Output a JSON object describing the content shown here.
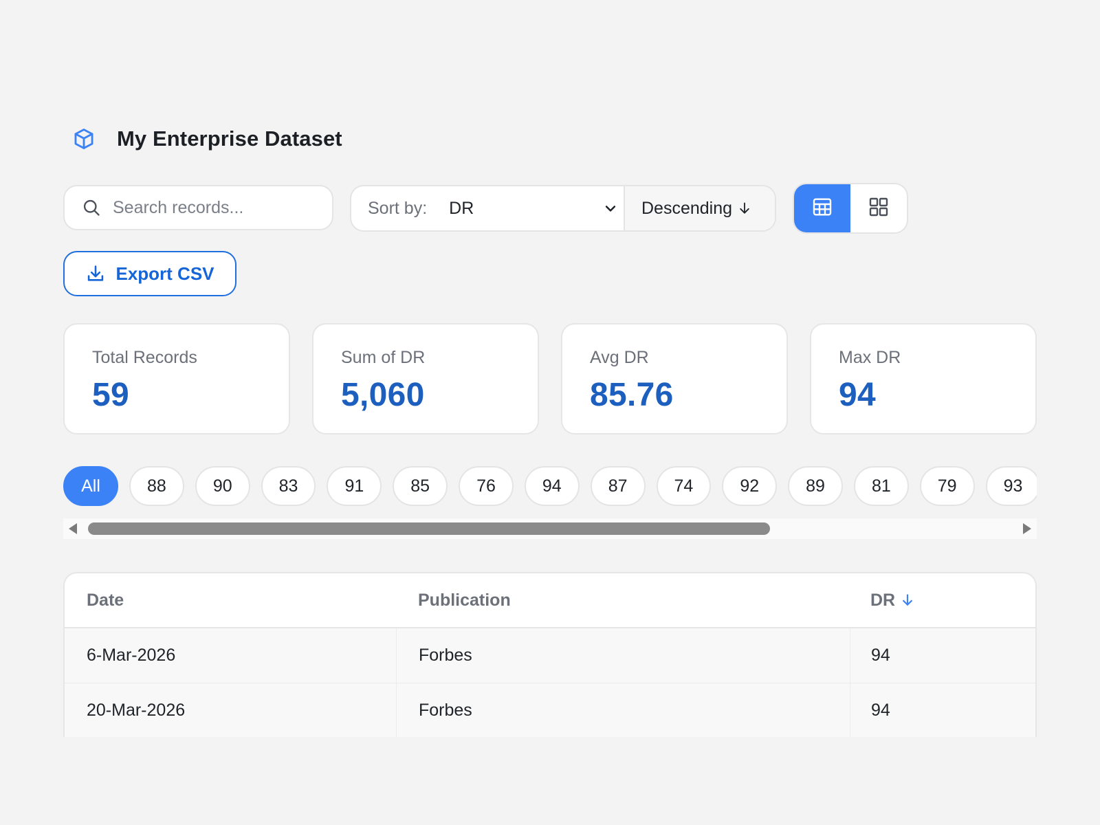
{
  "header": {
    "title": "My Enterprise Dataset",
    "logo_icon": "cube-icon"
  },
  "search": {
    "placeholder": "Search records...",
    "value": ""
  },
  "sort": {
    "label": "Sort by:",
    "field": "DR",
    "direction": "Descending"
  },
  "view_toggle": {
    "active": "table",
    "options": [
      "table",
      "grid"
    ]
  },
  "export": {
    "label": "Export CSV"
  },
  "stats": [
    {
      "label": "Total Records",
      "value": "59"
    },
    {
      "label": "Sum of DR",
      "value": "5,060"
    },
    {
      "label": "Avg DR",
      "value": "85.76"
    },
    {
      "label": "Max DR",
      "value": "94"
    }
  ],
  "filters": [
    "All",
    "88",
    "90",
    "83",
    "91",
    "85",
    "76",
    "94",
    "87",
    "74",
    "92",
    "89",
    "81",
    "79",
    "93"
  ],
  "table": {
    "columns": [
      "Date",
      "Publication",
      "DR"
    ],
    "rows": [
      [
        "6-Mar-2026",
        "Forbes",
        "94"
      ],
      [
        "20-Mar-2026",
        "Forbes",
        "94"
      ]
    ]
  },
  "colors": {
    "accent": "#3b82f6",
    "stat_value": "#1c5fbe",
    "background": "#f3f3f3"
  }
}
